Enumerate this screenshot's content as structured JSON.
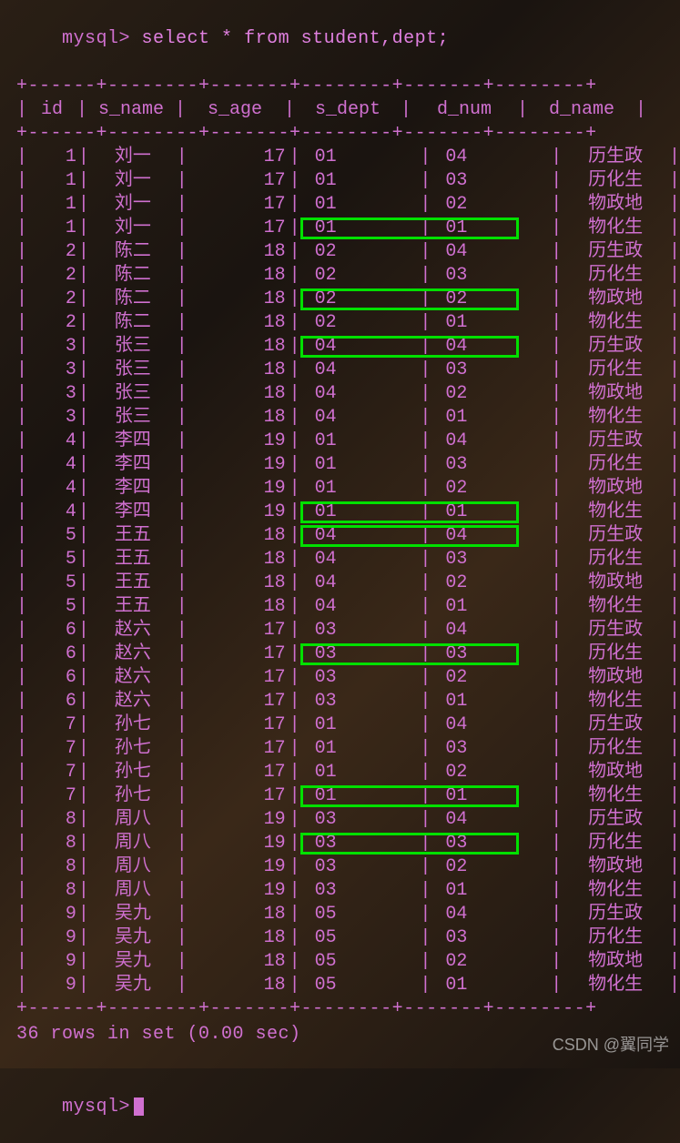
{
  "prompt": "mysql>",
  "query": "select * from student,dept;",
  "border_top": "+------+--------+-------+--------+-------+--------+",
  "border_mid": "+------+--------+-------+--------+-------+--------+",
  "border_bottom": "+------+--------+-------+--------+-------+--------+",
  "headers": [
    "id",
    "s_name",
    "s_age",
    "s_dept",
    "d_num",
    "d_name"
  ],
  "rows": [
    {
      "id": "1",
      "s_name": "刘一",
      "s_age": "17",
      "s_dept": "01",
      "d_num": "04",
      "d_name": "历生政",
      "hl": false
    },
    {
      "id": "1",
      "s_name": "刘一",
      "s_age": "17",
      "s_dept": "01",
      "d_num": "03",
      "d_name": "历化生",
      "hl": false
    },
    {
      "id": "1",
      "s_name": "刘一",
      "s_age": "17",
      "s_dept": "01",
      "d_num": "02",
      "d_name": "物政地",
      "hl": false
    },
    {
      "id": "1",
      "s_name": "刘一",
      "s_age": "17",
      "s_dept": "01",
      "d_num": "01",
      "d_name": "物化生",
      "hl": true
    },
    {
      "id": "2",
      "s_name": "陈二",
      "s_age": "18",
      "s_dept": "02",
      "d_num": "04",
      "d_name": "历生政",
      "hl": false
    },
    {
      "id": "2",
      "s_name": "陈二",
      "s_age": "18",
      "s_dept": "02",
      "d_num": "03",
      "d_name": "历化生",
      "hl": false
    },
    {
      "id": "2",
      "s_name": "陈二",
      "s_age": "18",
      "s_dept": "02",
      "d_num": "02",
      "d_name": "物政地",
      "hl": true
    },
    {
      "id": "2",
      "s_name": "陈二",
      "s_age": "18",
      "s_dept": "02",
      "d_num": "01",
      "d_name": "物化生",
      "hl": false
    },
    {
      "id": "3",
      "s_name": "张三",
      "s_age": "18",
      "s_dept": "04",
      "d_num": "04",
      "d_name": "历生政",
      "hl": true
    },
    {
      "id": "3",
      "s_name": "张三",
      "s_age": "18",
      "s_dept": "04",
      "d_num": "03",
      "d_name": "历化生",
      "hl": false
    },
    {
      "id": "3",
      "s_name": "张三",
      "s_age": "18",
      "s_dept": "04",
      "d_num": "02",
      "d_name": "物政地",
      "hl": false
    },
    {
      "id": "3",
      "s_name": "张三",
      "s_age": "18",
      "s_dept": "04",
      "d_num": "01",
      "d_name": "物化生",
      "hl": false
    },
    {
      "id": "4",
      "s_name": "李四",
      "s_age": "19",
      "s_dept": "01",
      "d_num": "04",
      "d_name": "历生政",
      "hl": false
    },
    {
      "id": "4",
      "s_name": "李四",
      "s_age": "19",
      "s_dept": "01",
      "d_num": "03",
      "d_name": "历化生",
      "hl": false
    },
    {
      "id": "4",
      "s_name": "李四",
      "s_age": "19",
      "s_dept": "01",
      "d_num": "02",
      "d_name": "物政地",
      "hl": false
    },
    {
      "id": "4",
      "s_name": "李四",
      "s_age": "19",
      "s_dept": "01",
      "d_num": "01",
      "d_name": "物化生",
      "hl": true
    },
    {
      "id": "5",
      "s_name": "王五",
      "s_age": "18",
      "s_dept": "04",
      "d_num": "04",
      "d_name": "历生政",
      "hl": true
    },
    {
      "id": "5",
      "s_name": "王五",
      "s_age": "18",
      "s_dept": "04",
      "d_num": "03",
      "d_name": "历化生",
      "hl": false
    },
    {
      "id": "5",
      "s_name": "王五",
      "s_age": "18",
      "s_dept": "04",
      "d_num": "02",
      "d_name": "物政地",
      "hl": false
    },
    {
      "id": "5",
      "s_name": "王五",
      "s_age": "18",
      "s_dept": "04",
      "d_num": "01",
      "d_name": "物化生",
      "hl": false
    },
    {
      "id": "6",
      "s_name": "赵六",
      "s_age": "17",
      "s_dept": "03",
      "d_num": "04",
      "d_name": "历生政",
      "hl": false
    },
    {
      "id": "6",
      "s_name": "赵六",
      "s_age": "17",
      "s_dept": "03",
      "d_num": "03",
      "d_name": "历化生",
      "hl": true
    },
    {
      "id": "6",
      "s_name": "赵六",
      "s_age": "17",
      "s_dept": "03",
      "d_num": "02",
      "d_name": "物政地",
      "hl": false
    },
    {
      "id": "6",
      "s_name": "赵六",
      "s_age": "17",
      "s_dept": "03",
      "d_num": "01",
      "d_name": "物化生",
      "hl": false
    },
    {
      "id": "7",
      "s_name": "孙七",
      "s_age": "17",
      "s_dept": "01",
      "d_num": "04",
      "d_name": "历生政",
      "hl": false
    },
    {
      "id": "7",
      "s_name": "孙七",
      "s_age": "17",
      "s_dept": "01",
      "d_num": "03",
      "d_name": "历化生",
      "hl": false
    },
    {
      "id": "7",
      "s_name": "孙七",
      "s_age": "17",
      "s_dept": "01",
      "d_num": "02",
      "d_name": "物政地",
      "hl": false
    },
    {
      "id": "7",
      "s_name": "孙七",
      "s_age": "17",
      "s_dept": "01",
      "d_num": "01",
      "d_name": "物化生",
      "hl": true
    },
    {
      "id": "8",
      "s_name": "周八",
      "s_age": "19",
      "s_dept": "03",
      "d_num": "04",
      "d_name": "历生政",
      "hl": false
    },
    {
      "id": "8",
      "s_name": "周八",
      "s_age": "19",
      "s_dept": "03",
      "d_num": "03",
      "d_name": "历化生",
      "hl": true
    },
    {
      "id": "8",
      "s_name": "周八",
      "s_age": "19",
      "s_dept": "03",
      "d_num": "02",
      "d_name": "物政地",
      "hl": false
    },
    {
      "id": "8",
      "s_name": "周八",
      "s_age": "19",
      "s_dept": "03",
      "d_num": "01",
      "d_name": "物化生",
      "hl": false
    },
    {
      "id": "9",
      "s_name": "吴九",
      "s_age": "18",
      "s_dept": "05",
      "d_num": "04",
      "d_name": "历生政",
      "hl": false
    },
    {
      "id": "9",
      "s_name": "吴九",
      "s_age": "18",
      "s_dept": "05",
      "d_num": "03",
      "d_name": "历化生",
      "hl": false
    },
    {
      "id": "9",
      "s_name": "吴九",
      "s_age": "18",
      "s_dept": "05",
      "d_num": "02",
      "d_name": "物政地",
      "hl": false
    },
    {
      "id": "9",
      "s_name": "吴九",
      "s_age": "18",
      "s_dept": "05",
      "d_num": "01",
      "d_name": "物化生",
      "hl": false
    }
  ],
  "footer": "36 rows in set (0.00 sec)",
  "watermark": "CSDN @翼同学"
}
